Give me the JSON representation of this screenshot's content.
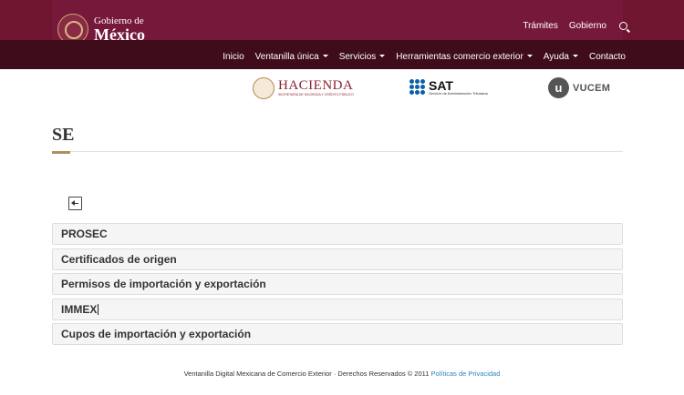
{
  "header": {
    "logo": {
      "line1": "Gobierno de",
      "line2": "México"
    },
    "top_links": [
      "Trámites",
      "Gobierno"
    ]
  },
  "nav": {
    "items": [
      {
        "label": "Inicio",
        "dropdown": false
      },
      {
        "label": "Ventanilla única",
        "dropdown": true
      },
      {
        "label": "Servicios",
        "dropdown": true
      },
      {
        "label": "Herramientas comercio exterior",
        "dropdown": true
      },
      {
        "label": "Ayuda",
        "dropdown": true
      },
      {
        "label": "Contacto",
        "dropdown": false
      }
    ]
  },
  "partners": {
    "hacienda": {
      "name": "HACIENDA",
      "subtitle": "SECRETARÍA DE HACIENDA Y CRÉDITO PÚBLICO"
    },
    "sat": {
      "name": "SAT",
      "subtitle": "Servicio de Administración Tributaria"
    },
    "vucem": {
      "letter": "u",
      "name": "VUCEM"
    }
  },
  "page": {
    "title": "SE"
  },
  "list": {
    "items": [
      "PROSEC",
      "Certificados de origen",
      "Permisos de importación y exportación",
      "IMMEX",
      "Cupos de importación y exportación"
    ]
  },
  "footer": {
    "text": "Ventanilla Digital Mexicana de Comercio Exterior · Derechos Reservados © 2011 ",
    "link": "Políticas de Privacidad"
  },
  "colors": {
    "header_bg": "#6f1530",
    "nav_bg": "#3f0c1c",
    "accent": "#b38e5d",
    "link": "#2a86c2"
  }
}
